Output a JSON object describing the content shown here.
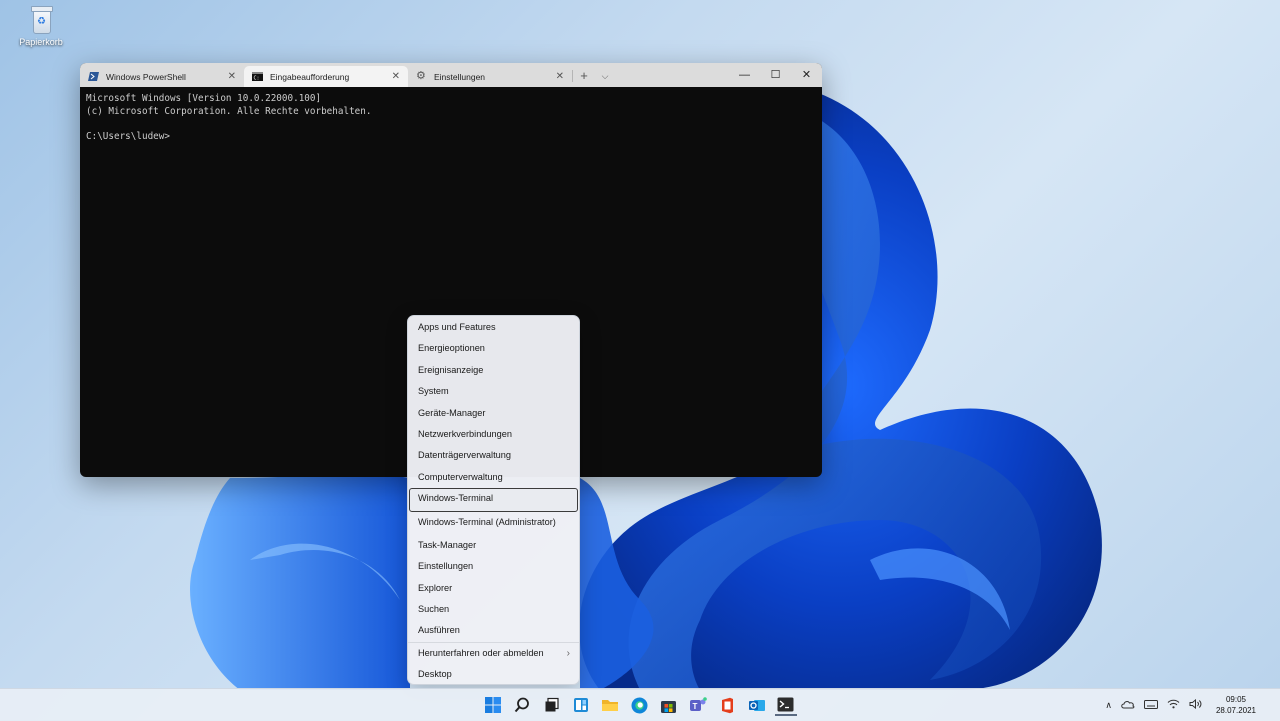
{
  "desktop": {
    "recycle_bin_label": "Papierkorb"
  },
  "terminal": {
    "tabs": [
      {
        "label": "Windows PowerShell",
        "icon": "powershell-icon"
      },
      {
        "label": "Eingabeaufforderung",
        "icon": "cmd-icon"
      },
      {
        "label": "Einstellungen",
        "icon": "gear-icon"
      }
    ],
    "new_tab": "+",
    "dropdown": "⌵",
    "minimize": "—",
    "maximize": "☐",
    "close": "✕",
    "console_lines": [
      "Microsoft Windows [Version 10.0.22000.100]",
      "(c) Microsoft Corporation. Alle Rechte vorbehalten.",
      "",
      "C:\\Users\\ludew>"
    ]
  },
  "context_menu": {
    "items": [
      "Apps und Features",
      "Energieoptionen",
      "Ereignisanzeige",
      "System",
      "Geräte-Manager",
      "Netzwerkverbindungen",
      "Datenträgerverwaltung",
      "Computerverwaltung",
      "Windows-Terminal",
      "Windows-Terminal (Administrator)",
      "Task-Manager",
      "Einstellungen",
      "Explorer",
      "Suchen",
      "Ausführen",
      "Herunterfahren oder abmelden",
      "Desktop"
    ],
    "selected": "Windows-Terminal"
  },
  "taskbar": {
    "apps": [
      "start-icon",
      "search-icon",
      "task-view-icon",
      "widgets-icon",
      "file-explorer-icon",
      "edge-icon",
      "store-icon",
      "teams-icon",
      "office-icon",
      "outlook-icon",
      "terminal-icon"
    ],
    "tray": {
      "chevron": "∧",
      "time": "09:05",
      "date": "28.07.2021"
    }
  },
  "colors": {
    "accent": "#0067c0",
    "terminal_bg": "#0c0c0c",
    "terminal_fg": "#cccccc"
  }
}
